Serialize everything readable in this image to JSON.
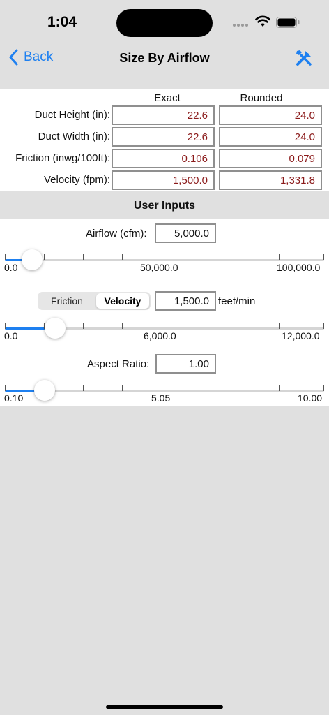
{
  "status": {
    "time": "1:04"
  },
  "nav": {
    "back_label": "Back",
    "title": "Size By Airflow"
  },
  "results": {
    "header_exact": "Exact",
    "header_rounded": "Rounded",
    "rows": [
      {
        "label": "Duct Height (in):",
        "exact": "22.6",
        "rounded": "24.0"
      },
      {
        "label": "Duct Width (in):",
        "exact": "22.6",
        "rounded": "24.0"
      },
      {
        "label": "Friction (inwg/100ft):",
        "exact": "0.106",
        "rounded": "0.079"
      },
      {
        "label": "Velocity (fpm):",
        "exact": "1,500.0",
        "rounded": "1,331.8"
      }
    ]
  },
  "inputs": {
    "section_title": "User Inputs",
    "airflow": {
      "label": "Airflow (cfm):",
      "value": "5,000.0",
      "slider": {
        "min_label": "0.0",
        "mid_label": "50,000.0",
        "max_label": "100,000.0",
        "position_fraction": 0.05
      }
    },
    "mode": {
      "options": [
        "Friction",
        "Velocity"
      ],
      "selected": "Velocity",
      "value": "1,500.0",
      "unit": "feet/min",
      "slider": {
        "min_label": "0.0",
        "mid_label": "6,000.0",
        "max_label": "12,000.0",
        "position_fraction": 0.125
      }
    },
    "aspect": {
      "label": "Aspect Ratio:",
      "value": "1.00",
      "slider": {
        "min_label": "0.10",
        "mid_label": "5.05",
        "max_label": "10.00",
        "position_fraction": 0.091
      }
    }
  },
  "colors": {
    "accent": "#1e80f0",
    "result_text": "#8b1a1a",
    "background": "#e0e0e0"
  }
}
